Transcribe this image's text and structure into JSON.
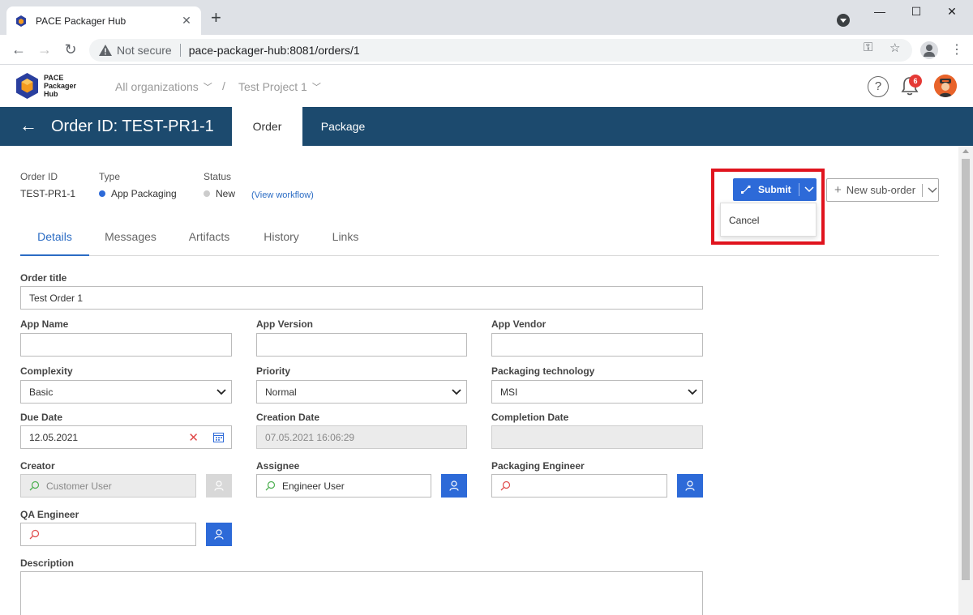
{
  "browser": {
    "tab_title": "PACE Packager Hub",
    "not_secure": "Not secure",
    "url": "pace-packager-hub:8081/orders/1"
  },
  "app": {
    "logo_lines": [
      "PACE",
      "Packager",
      "Hub"
    ],
    "organization": "All organizations",
    "crumb_sep": "/",
    "project": "Test Project 1",
    "notification_count": "6"
  },
  "banner": {
    "title": "Order ID: TEST-PR1-1",
    "tabs": [
      "Order",
      "Package"
    ]
  },
  "meta": {
    "order_id_label": "Order ID",
    "order_id_value": "TEST-PR1-1",
    "type_label": "Type",
    "type_value": "App Packaging",
    "type_color": "#2d6ad8",
    "status_label": "Status",
    "status_value": "New",
    "status_color": "#cccccc",
    "view_workflow": "(View workflow)"
  },
  "actions": {
    "submit": "Submit",
    "dropdown_cancel": "Cancel",
    "new_suborder": "New sub-order"
  },
  "subtabs": [
    "Details",
    "Messages",
    "Artifacts",
    "History",
    "Links"
  ],
  "form": {
    "order_title_label": "Order title",
    "order_title_value": "Test Order 1",
    "app_name_label": "App Name",
    "app_name_value": "",
    "app_version_label": "App Version",
    "app_version_value": "",
    "app_vendor_label": "App Vendor",
    "app_vendor_value": "",
    "complexity_label": "Complexity",
    "complexity_value": "Basic",
    "priority_label": "Priority",
    "priority_value": "Normal",
    "packaging_tech_label": "Packaging technology",
    "packaging_tech_value": "MSI",
    "due_date_label": "Due Date",
    "due_date_value": "12.05.2021",
    "creation_date_label": "Creation Date",
    "creation_date_value": "07.05.2021 16:06:29",
    "completion_date_label": "Completion Date",
    "completion_date_value": "",
    "creator_label": "Creator",
    "creator_value": "Customer User",
    "assignee_label": "Assignee",
    "assignee_value": "Engineer User",
    "packaging_engineer_label": "Packaging Engineer",
    "packaging_engineer_value": "",
    "qa_engineer_label": "QA Engineer",
    "qa_engineer_value": "",
    "description_label": "Description",
    "description_value": ""
  },
  "colors": {
    "banner": "#1c4a6e",
    "accent": "#2d6ad8",
    "highlight": "#e0141e"
  }
}
